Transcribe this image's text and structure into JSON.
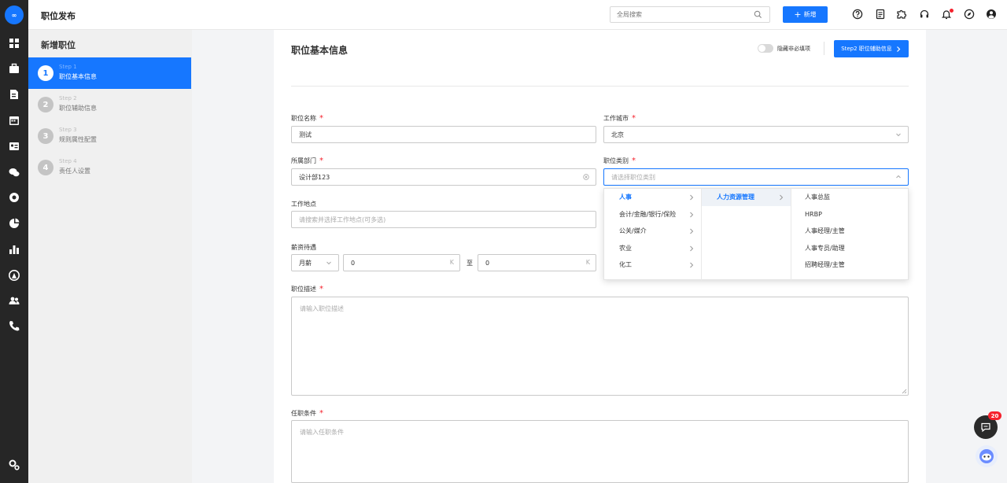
{
  "app": {
    "title": "职位发布",
    "logo_text": "∞"
  },
  "search": {
    "placeholder": "全局搜索"
  },
  "toolbar": {
    "new_label": "新增"
  },
  "sidebar": {
    "title": "新增职位",
    "steps": [
      {
        "num": "1",
        "sub": "Step 1",
        "label": "职位基本信息",
        "active": true
      },
      {
        "num": "2",
        "sub": "Step 2",
        "label": "职位辅助信息",
        "active": false
      },
      {
        "num": "3",
        "sub": "Step 3",
        "label": "规则属性配置",
        "active": false
      },
      {
        "num": "4",
        "sub": "Step 4",
        "label": "责任人设置",
        "active": false
      }
    ]
  },
  "form": {
    "title": "职位基本信息",
    "toggle_label": "隐藏非必填项",
    "toggle_on": false,
    "next_button": "Step2 职位辅助信息",
    "fields": {
      "name": {
        "label": "职位名称",
        "value": "测试"
      },
      "city": {
        "label": "工作城市",
        "value": "北京"
      },
      "dept": {
        "label": "所属部门",
        "value": "设计部123"
      },
      "category": {
        "label": "职位类别",
        "placeholder": "请选择职位类别"
      },
      "location": {
        "label": "工作地点",
        "placeholder": "请搜索并选择工作地点(可多选)"
      },
      "salary": {
        "label": "薪资待遇",
        "type": "月薪",
        "min": "0",
        "max": "0",
        "unit": "K",
        "sep": "至"
      },
      "description": {
        "label": "职位描述",
        "placeholder": "请输入职位描述"
      },
      "requirements": {
        "label": "任职条件",
        "placeholder": "请输入任职条件"
      },
      "required_mark": "*"
    },
    "category_dropdown": {
      "level1": [
        "人事",
        "会计/金融/银行/保险",
        "公关/媒介",
        "农业",
        "化工"
      ],
      "level1_selected": "人事",
      "level2": [
        "人力资源管理"
      ],
      "level2_selected": "人力资源管理",
      "level3": [
        "人事总监",
        "HRBP",
        "人事经理/主管",
        "人事专员/助理",
        "招聘经理/主管"
      ]
    }
  },
  "chat_widget": {
    "badge": "20"
  },
  "colors": {
    "primary": "#1677ff",
    "rail": "#262626",
    "required": "#f5222d"
  }
}
